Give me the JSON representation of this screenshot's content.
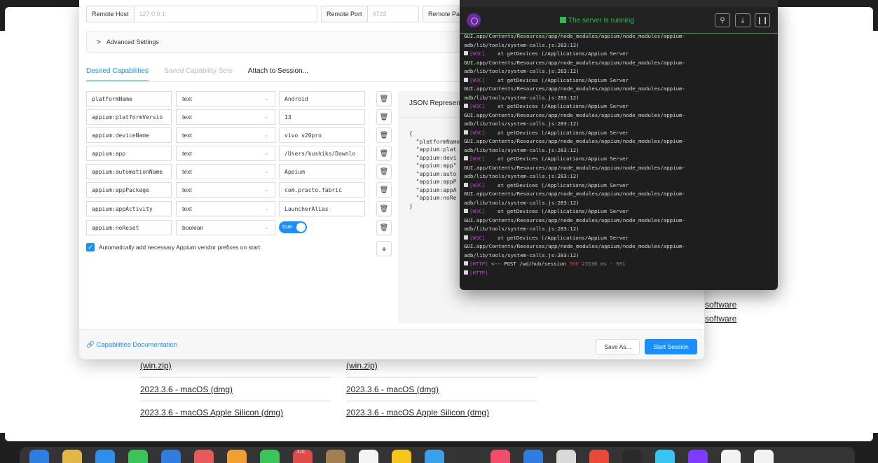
{
  "appium": {
    "remote": [
      {
        "label": "Remote Host",
        "value": "127.0.0.1"
      },
      {
        "label": "Remote Port",
        "value": "4723"
      },
      {
        "label": "Remote Path",
        "value": ""
      }
    ],
    "advanced_settings": "Advanced Settings",
    "tabs": [
      "Desired Capabilities",
      "Saved Capability Sets",
      "Attach to Session..."
    ],
    "capabilities": [
      {
        "name": "platformName",
        "type": "text",
        "value": "Android"
      },
      {
        "name": "appium:platformVersio",
        "type": "text",
        "value": "13"
      },
      {
        "name": "appium:deviceName",
        "type": "text",
        "value": "vivo v20pro"
      },
      {
        "name": "appium:app",
        "type": "text",
        "value": "/Users/kushiks/Downlo"
      },
      {
        "name": "appium:automationName",
        "type": "text",
        "value": "Appium"
      },
      {
        "name": "appium:appPackage",
        "type": "text",
        "value": "com.practo.fabric"
      },
      {
        "name": "appium:appActivity",
        "type": "text",
        "value": "LauncherAlias"
      },
      {
        "name": "appium:noReset",
        "type": "boolean",
        "value": "true"
      }
    ],
    "vendor_prefix_label": "Automatically add necessary Appium vendor prefixes on start",
    "json_title": "JSON Represen",
    "json_lines": [
      "{",
      "  \"platformName",
      "  \"appium:plat",
      "  \"appium:devi",
      "  \"appium:app\"",
      "  \"appium:auto",
      "  \"appium:appP",
      "  \"appium:appA",
      "  \"appium:noRe",
      "}"
    ],
    "docs_link": "Capabilities Documentation",
    "save_as": "Save As...",
    "start_session": "Start Session"
  },
  "server": {
    "status": "The server is running",
    "log_path_1": "GUI.app/Contents/Resources/app/node_modules/appium/node_modules/appium-",
    "log_path_2": "adb/lib/tools/system-calls.js:283:12)",
    "log_w3c": "[W3C]",
    "log_getdevices": "    at getDevices (/Applications/Appium Server",
    "last_tag": "[HTTP]",
    "last_msg": " <-- POST /wd/hub/session ",
    "last_code": "500",
    "last_time": " 23536 ms - 691",
    "final_tag": "[HTTP]"
  },
  "background": {
    "links_left": [
      "(win.zip)",
      "2023.3.6 - macOS (dmg)",
      "2023.3.6 - macOS Apple Silicon (dmg)"
    ],
    "links_right": [
      "(win.zip)",
      "2023.3.6 - macOS (dmg)",
      "2023.3.6 - macOS Apple Silicon (dmg)"
    ],
    "software_1": "software",
    "software_2": "software"
  },
  "dock": {
    "calendar_month": "JUN",
    "icon_colors": [
      "#2f7de1",
      "#e0b84a",
      "#2f8fe8",
      "#3bc45a",
      "#2f7de1",
      "#e85a5a",
      "#f0a030",
      "#3bc45a",
      "#e24b4b",
      "#a08050",
      "#f4f4f4",
      "#f5c518",
      "#3aa0e8",
      "#333333",
      "#f24e6b",
      "#2f7de1",
      "#d9d9d9",
      "#e84a3a",
      "#2b2b2b",
      "#36c5f0",
      "#7d3cff",
      "#f2f2f2",
      "#f2f2f2"
    ]
  }
}
